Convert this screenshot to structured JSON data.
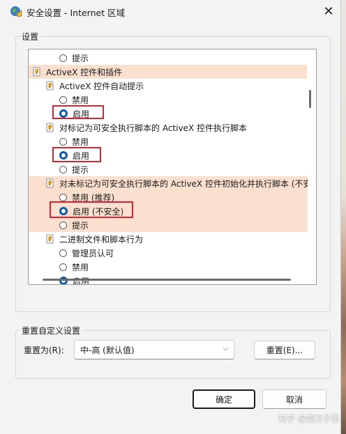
{
  "window": {
    "title": "安全设置 - Internet 区域",
    "close_icon": "close-icon"
  },
  "settings_group": {
    "label": "设置",
    "rows": [
      {
        "type": "radio",
        "label": "提示",
        "checked": false,
        "indent": 2,
        "highlight": false
      },
      {
        "type": "category",
        "label": "ActiveX 控件和插件",
        "indent": 0,
        "highlight": true
      },
      {
        "type": "category",
        "label": "ActiveX 控件自动提示",
        "indent": 1,
        "highlight": false
      },
      {
        "type": "radio",
        "label": "禁用",
        "checked": false,
        "indent": 2,
        "highlight": false
      },
      {
        "type": "radio",
        "label": "启用",
        "checked": true,
        "indent": 2,
        "highlight": false
      },
      {
        "type": "category",
        "label": "对标记为可安全执行脚本的 ActiveX 控件执行脚本",
        "indent": 1,
        "highlight": false
      },
      {
        "type": "radio",
        "label": "禁用",
        "checked": false,
        "indent": 2,
        "highlight": false
      },
      {
        "type": "radio",
        "label": "启用",
        "checked": true,
        "indent": 2,
        "highlight": false
      },
      {
        "type": "radio",
        "label": "提示",
        "checked": false,
        "indent": 2,
        "highlight": false
      },
      {
        "type": "category",
        "label": "对未标记为可安全执行脚本的 ActiveX 控件初始化并执行脚本 (不安",
        "indent": 1,
        "highlight": true
      },
      {
        "type": "radio",
        "label": "禁用 (推荐)",
        "checked": false,
        "indent": 2,
        "highlight": true
      },
      {
        "type": "radio",
        "label": "启用 (不安全)",
        "checked": true,
        "indent": 2,
        "highlight": true
      },
      {
        "type": "radio",
        "label": "提示",
        "checked": false,
        "indent": 2,
        "highlight": true
      },
      {
        "type": "category",
        "label": "二进制文件和脚本行为",
        "indent": 1,
        "highlight": false
      },
      {
        "type": "radio",
        "label": "管理员认可",
        "checked": false,
        "indent": 2,
        "highlight": false
      },
      {
        "type": "radio",
        "label": "禁用",
        "checked": false,
        "indent": 2,
        "highlight": false
      },
      {
        "type": "radio",
        "label": "启用",
        "checked": true,
        "indent": 2,
        "highlight": false
      }
    ]
  },
  "reset_group": {
    "label": "重置自定义设置",
    "reset_to_label": "重置为(R):",
    "select_value": "中-高 (默认值)",
    "reset_button": "重置(E)..."
  },
  "footer": {
    "ok_button": "确定",
    "cancel_button": "取消"
  },
  "watermark": "知乎 @南方子墨",
  "colors": {
    "highlight": "#fbe0cf",
    "annotation_red": "#d9242f",
    "radio_checked": "#0a5aa8"
  }
}
